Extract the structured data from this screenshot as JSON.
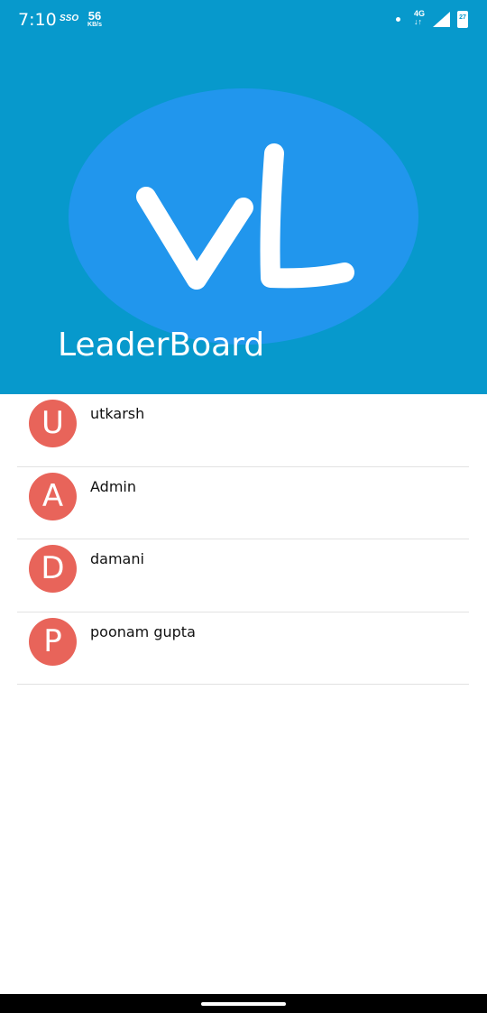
{
  "status_bar": {
    "time": "7:10",
    "sso": "SSO",
    "speed_value": "56",
    "speed_unit": "KB/s",
    "network": "4G",
    "battery": "27"
  },
  "header": {
    "logo_text": "vL",
    "title": "LeaderBoard",
    "background_color": "#0799cc",
    "logo_color": "#2196ed"
  },
  "leaderboard": {
    "items": [
      {
        "initial": "U",
        "name": "utkarsh"
      },
      {
        "initial": "A",
        "name": "Admin"
      },
      {
        "initial": "D",
        "name": "damani"
      },
      {
        "initial": "P",
        "name": "poonam gupta"
      }
    ],
    "avatar_color": "#e8645a"
  }
}
